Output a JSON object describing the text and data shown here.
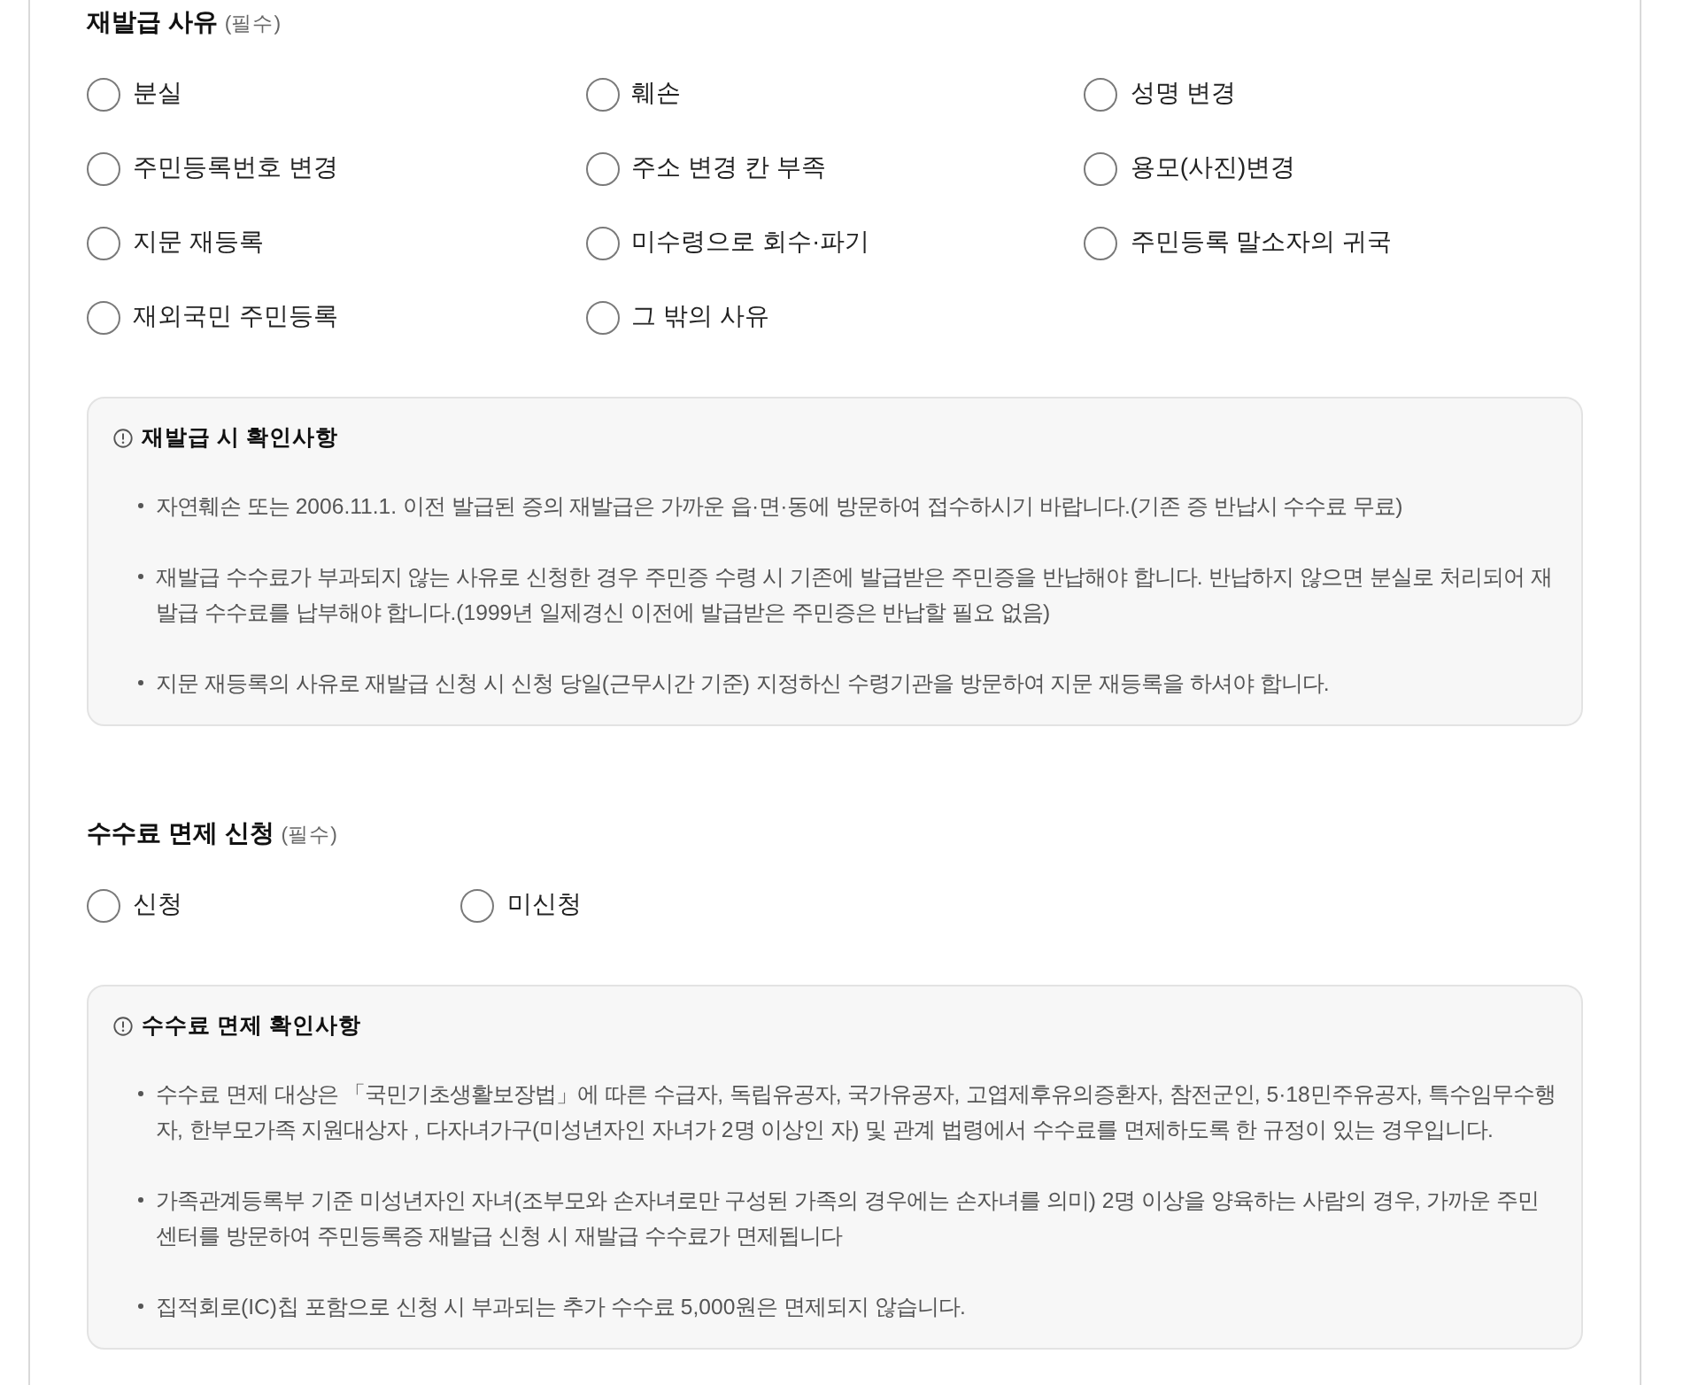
{
  "sections": [
    {
      "title": "재발급 사유",
      "note": "(필수)",
      "options": [
        {
          "label": "분실",
          "selected": false
        },
        {
          "label": "훼손",
          "selected": false
        },
        {
          "label": "성명 변경",
          "selected": false
        },
        {
          "label": "주민등록번호 변경",
          "selected": false
        },
        {
          "label": "주소 변경 칸 부족",
          "selected": false
        },
        {
          "label": "용모(사진)변경",
          "selected": false
        },
        {
          "label": "지문 재등록",
          "selected": false
        },
        {
          "label": "미수령으로 회수·파기",
          "selected": false
        },
        {
          "label": "주민등록 말소자의 귀국",
          "selected": false
        },
        {
          "label": "재외국민 주민등록",
          "selected": false
        },
        {
          "label": "그 밖의 사유",
          "selected": false
        }
      ],
      "notice": {
        "title": "재발급 시 확인사항",
        "items": [
          "자연훼손 또는 2006.11.1. 이전 발급된 증의 재발급은 가까운 읍·면·동에 방문하여 접수하시기 바랍니다.(기존 증 반납시 수수료 무료)",
          "재발급 수수료가 부과되지 않는 사유로 신청한 경우 주민증 수령 시 기존에 발급받은 주민증을 반납해야 합니다. 반납하지 않으면 분실로 처리되어 재발급 수수료를 납부해야 합니다.(1999년 일제경신 이전에 발급받은 주민증은 반납할 필요 없음)",
          "지문 재등록의 사유로 재발급 신청 시 신청 당일(근무시간 기준) 지정하신 수령기관을 방문하여 지문 재등록을 하셔야 합니다."
        ]
      }
    },
    {
      "title": "수수료 면제 신청",
      "note": "(필수)",
      "options": [
        {
          "label": "신청",
          "selected": false
        },
        {
          "label": "미신청",
          "selected": false
        }
      ],
      "notice": {
        "title": "수수료 면제 확인사항",
        "items": [
          "수수료 면제 대상은 「국민기초생활보장법」에 따른 수급자, 독립유공자, 국가유공자, 고엽제후유의증환자, 참전군인, 5·18민주유공자, 특수임무수행자, 한부모가족 지원대상자 , 다자녀가구(미성년자인 자녀가 2명 이상인 자) 및 관계 법령에서 수수료를 면제하도록 한 규정이 있는 경우입니다.",
          "가족관계등록부 기준 미성년자인 자녀(조부모와 손자녀로만 구성된 가족의 경우에는 손자녀를 의미) 2명 이상을 양육하는 사람의 경우, 가까운 주민센터를 방문하여 주민등록증 재발급 신청 시 재발급 수수료가 면제됩니다",
          "집적회로(IC)칩 포함으로 신청 시 부과되는 추가 수수료 5,000원은 면제되지 않습니다."
        ]
      }
    }
  ]
}
